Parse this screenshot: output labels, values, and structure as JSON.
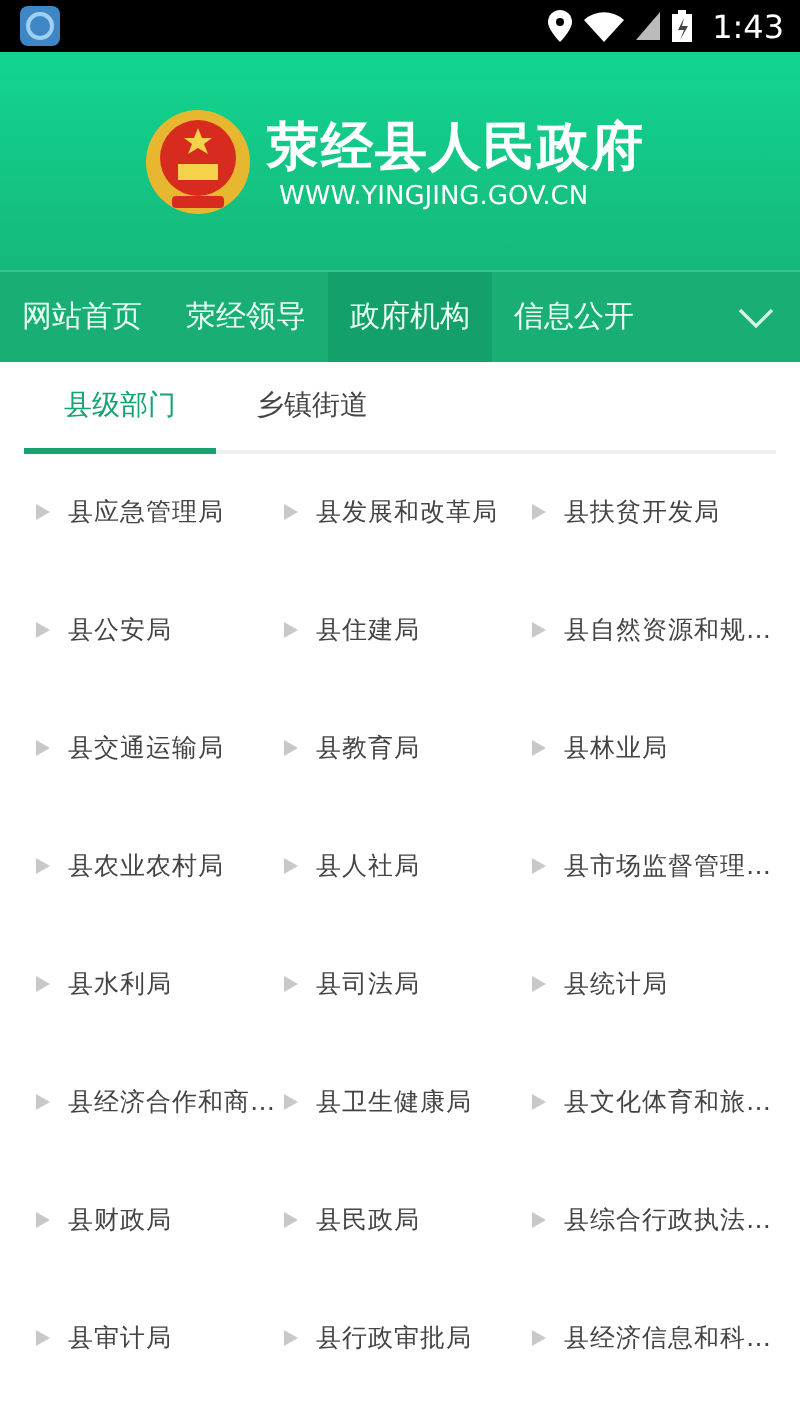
{
  "status_bar": {
    "time": "1:43"
  },
  "header": {
    "title": "荥经县人民政府",
    "url": "WWW.YINGJING.GOV.CN"
  },
  "nav": {
    "items": [
      {
        "label": "网站首页",
        "selected": false
      },
      {
        "label": "荥经领导",
        "selected": false
      },
      {
        "label": "政府机构",
        "selected": true
      },
      {
        "label": "信息公开",
        "selected": false
      }
    ]
  },
  "tabs": [
    {
      "label": "县级部门",
      "selected": true
    },
    {
      "label": "乡镇街道",
      "selected": false
    }
  ],
  "departments": [
    "县应急管理局",
    "县发展和改革局",
    "县扶贫开发局",
    "县公安局",
    "县住建局",
    "县自然资源和规…",
    "县交通运输局",
    "县教育局",
    "县林业局",
    "县农业农村局",
    "县人社局",
    "县市场监督管理…",
    "县水利局",
    "县司法局",
    "县统计局",
    "县经济合作和商…",
    "县卫生健康局",
    "县文化体育和旅…",
    "县财政局",
    "县民政局",
    "县综合行政执法…",
    "县审计局",
    "县行政审批局",
    "县经济信息和科…"
  ]
}
